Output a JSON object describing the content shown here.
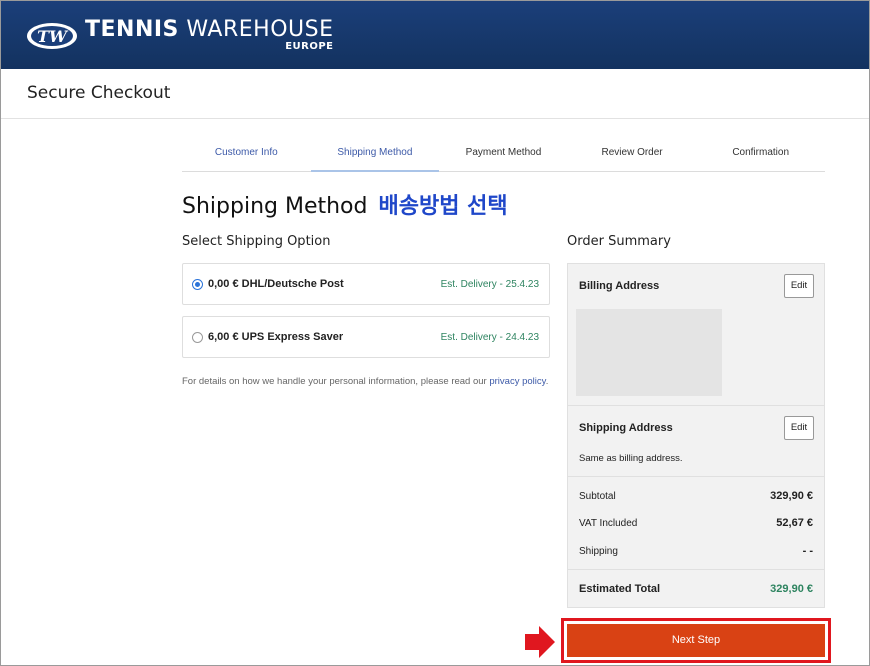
{
  "header": {
    "brand_main_bold": "TENNIS",
    "brand_main_light": " WAREHOUSE",
    "brand_sub": "EUROPE",
    "logo_letters": "TW",
    "bg_color": "#1b3f7a"
  },
  "checkout": {
    "title": "Secure Checkout"
  },
  "steps": [
    {
      "label": "Customer Info",
      "state": "done"
    },
    {
      "label": "Shipping Method",
      "state": "active"
    },
    {
      "label": "Payment Method",
      "state": "pending"
    },
    {
      "label": "Review Order",
      "state": "pending"
    },
    {
      "label": "Confirmation",
      "state": "pending"
    }
  ],
  "page": {
    "heading": "Shipping Method",
    "annotation": "배송방법 선택",
    "annotation_color": "#1f47c9"
  },
  "shipping": {
    "section_title": "Select Shipping Option",
    "options": [
      {
        "label": "0,00 € DHL/Deutsche Post",
        "eta": "Est. Delivery - 25.4.23",
        "selected": true
      },
      {
        "label": "6,00 € UPS Express Saver",
        "eta": "Est. Delivery - 24.4.23",
        "selected": false
      }
    ],
    "privacy_text": "For details on how we handle your personal information, please read our ",
    "privacy_link": "privacy policy",
    "privacy_end": "."
  },
  "summary": {
    "title": "Order Summary",
    "billing_label": "Billing Address",
    "shipping_label": "Shipping Address",
    "shipping_note": "Same as billing address.",
    "edit_label": "Edit",
    "subtotal_label": "Subtotal",
    "subtotal_value": "329,90 €",
    "vat_label": "VAT Included",
    "vat_value": "52,67 €",
    "shipping_cost_label": "Shipping",
    "shipping_cost_value": "- -",
    "total_label": "Estimated Total",
    "total_value": "329,90 €",
    "total_color": "#2e8460"
  },
  "actions": {
    "next_label": "Next Step",
    "next_color": "#d94214",
    "highlight_color": "#e0171f"
  }
}
